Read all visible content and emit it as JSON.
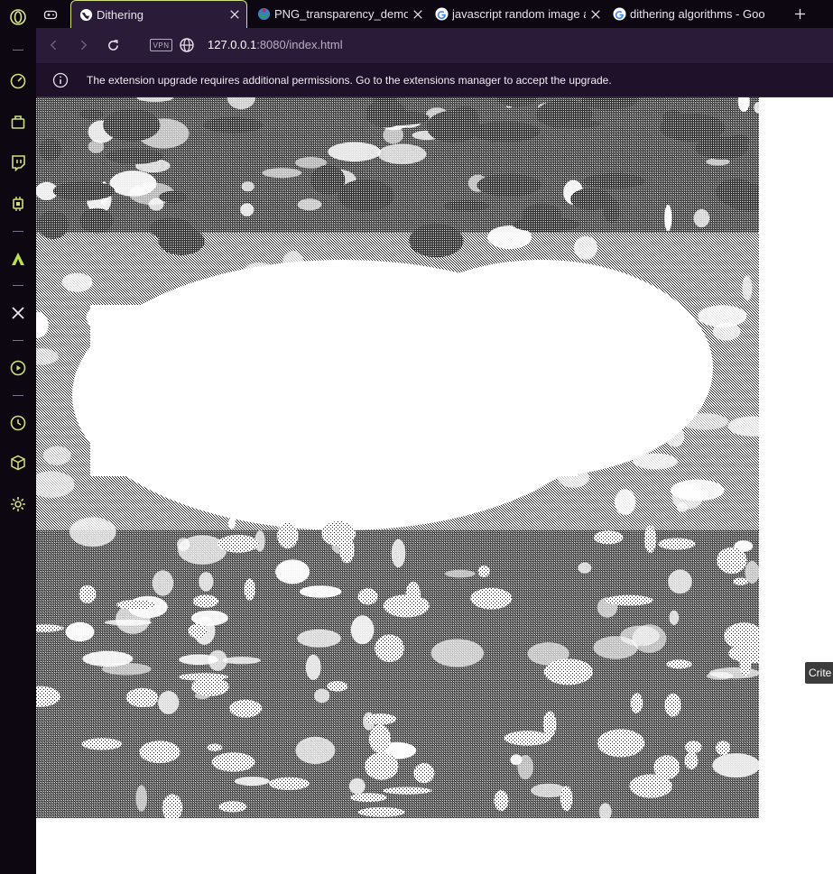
{
  "browser": {
    "accent_color": "#cfe07a",
    "tabs": [
      {
        "title": "Dithering",
        "icon": "globe-icon",
        "active": true
      },
      {
        "title": "PNG_transparency_demons",
        "icon": "wikimedia-icon",
        "active": false
      },
      {
        "title": "javascript random image ap",
        "icon": "google-icon",
        "active": false
      },
      {
        "title": "dithering algorithms - Goo",
        "icon": "google-icon",
        "active": false
      }
    ],
    "pinned_tab_icon": "gamepad-icon",
    "new_tab_icon": "plus-icon",
    "vpn_label": "VPN",
    "url_host": "127.0.0.1",
    "url_rest": ":8080/index.html"
  },
  "infobar": {
    "message": "The extension upgrade requires additional permissions. Go to the extensions manager to accept the upgrade."
  },
  "sidebar": {
    "items": [
      {
        "name": "opera-logo-icon"
      },
      {
        "name": "speed-dial-icon"
      },
      {
        "name": "shopping-bag-icon"
      },
      {
        "name": "twitch-icon"
      },
      {
        "name": "chip-icon"
      },
      {
        "name": "aria-icon"
      },
      {
        "name": "x-twitter-icon"
      },
      {
        "name": "player-icon"
      },
      {
        "name": "history-icon"
      },
      {
        "name": "extensions-cube-icon"
      },
      {
        "name": "settings-gear-icon"
      }
    ]
  },
  "page": {
    "image_description_icon": "dithered-image",
    "tooltip_text": "Crite"
  }
}
